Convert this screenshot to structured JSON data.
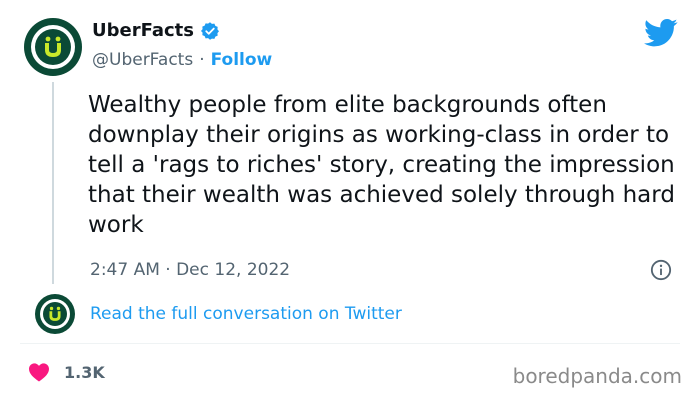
{
  "author": {
    "display_name": "UberFacts",
    "handle": "@UberFacts",
    "separator": "·",
    "follow_label": "Follow"
  },
  "tweet": {
    "text": "Wealthy people from elite backgrounds often downplay their origins as working-class in order to tell a 'rags to riches' story, creating the impression that their wealth was achieved solely through hard work",
    "timestamp": "2:47 AM · Dec 12, 2022"
  },
  "conversation": {
    "link_label": "Read the full conversation on Twitter"
  },
  "engagement": {
    "likes": "1.3K"
  },
  "watermark": "boredpanda.com",
  "colors": {
    "accent": "#1d9bf0",
    "avatar_dark": "#0b4a36",
    "avatar_green": "#c9e82a",
    "heart": "#f91880"
  },
  "icons": {
    "verified": "verified-badge-icon",
    "bird": "twitter-bird-icon",
    "info": "info-icon",
    "heart": "heart-icon"
  }
}
